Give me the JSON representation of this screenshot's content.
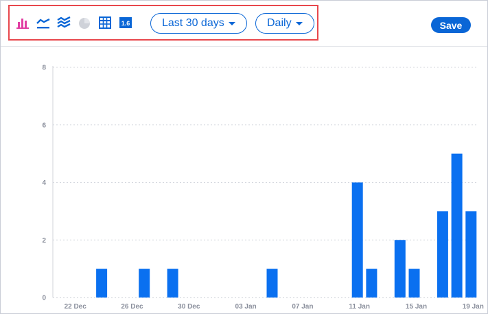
{
  "toolbar": {
    "view_icons": [
      "bar-chart-icon",
      "line-chart-icon",
      "stacked-area-icon",
      "pie-chart-icon",
      "table-icon",
      "number-icon"
    ],
    "number_icon_text": "1.6",
    "date_range": "Last 30 days",
    "interval": "Daily",
    "save_label": "Save",
    "colors": {
      "active_icon": "#e13fa3",
      "accent": "#0a66d6",
      "disabled_icon": "#cfd2d9",
      "highlight_border": "#e8474c"
    }
  },
  "chart_data": {
    "type": "bar",
    "categories": [
      "21 Dec",
      "22 Dec",
      "23 Dec",
      "24 Dec",
      "25 Dec",
      "26 Dec",
      "27 Dec",
      "28 Dec",
      "29 Dec",
      "30 Dec",
      "31 Dec",
      "01 Jan",
      "02 Jan",
      "03 Jan",
      "04 Jan",
      "05 Jan",
      "06 Jan",
      "07 Jan",
      "08 Jan",
      "09 Jan",
      "10 Jan",
      "11 Jan",
      "12 Jan",
      "13 Jan",
      "14 Jan",
      "15 Jan",
      "16 Jan",
      "17 Jan",
      "18 Jan",
      "19 Jan",
      "20 Jan"
    ],
    "values": [
      0,
      0,
      0,
      1,
      0,
      0,
      1,
      0,
      1,
      0,
      0,
      0,
      0,
      0,
      0,
      1,
      0,
      0,
      0,
      0,
      0,
      4,
      1,
      0,
      2,
      1,
      0,
      3,
      5,
      3,
      0
    ],
    "x_tick_labels": [
      "22 Dec",
      "26 Dec",
      "30 Dec",
      "03 Jan",
      "07 Jan",
      "11 Jan",
      "15 Jan",
      "19 Jan"
    ],
    "y_ticks": [
      0,
      2,
      4,
      6,
      8
    ],
    "ylim": [
      0,
      8
    ],
    "grid": true,
    "bar_color": "#0a70f0"
  }
}
